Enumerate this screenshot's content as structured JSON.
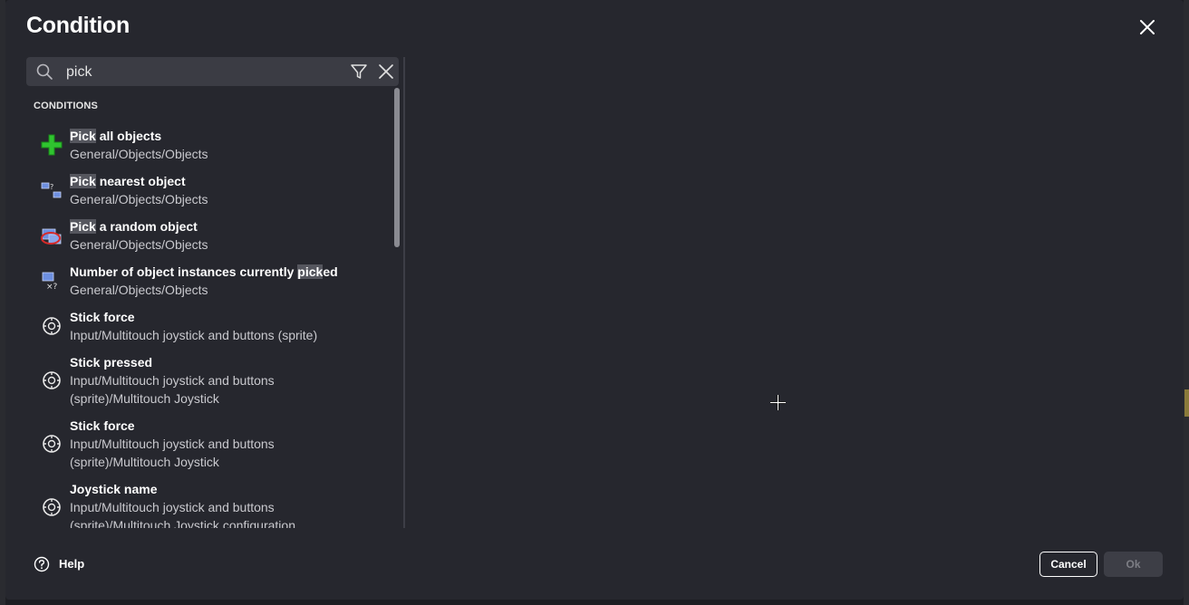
{
  "dialog": {
    "title": "Condition"
  },
  "search": {
    "value": "pick",
    "placeholder": ""
  },
  "list": {
    "section_label": "CONDITIONS",
    "items": [
      {
        "name_pre": "",
        "name_hl": "Pick",
        "name_post": " all objects",
        "path": "General/Objects/Objects",
        "icon": "green-plus-icon"
      },
      {
        "name_pre": "",
        "name_hl": "Pick",
        "name_post": " nearest object",
        "path": "General/Objects/Objects",
        "icon": "nearest-object-icon"
      },
      {
        "name_pre": "",
        "name_hl": "Pick",
        "name_post": " a random object",
        "path": "General/Objects/Objects",
        "icon": "random-object-icon"
      },
      {
        "name_pre": "Number of object instances currently ",
        "name_hl": "pick",
        "name_post": "ed",
        "path": "General/Objects/Objects",
        "icon": "object-count-icon"
      },
      {
        "name_pre": "Stick force",
        "name_hl": "",
        "name_post": "",
        "path": "Input/Multitouch joystick and buttons (sprite)",
        "icon": "joystick-icon"
      },
      {
        "name_pre": "Stick pressed",
        "name_hl": "",
        "name_post": "",
        "path": "Input/Multitouch joystick and buttons (sprite)/Multitouch Joystick",
        "icon": "joystick-icon"
      },
      {
        "name_pre": "Stick force",
        "name_hl": "",
        "name_post": "",
        "path": "Input/Multitouch joystick and buttons (sprite)/Multitouch Joystick",
        "icon": "joystick-icon"
      },
      {
        "name_pre": "Joystick name",
        "name_hl": "",
        "name_post": "",
        "path": "Input/Multitouch joystick and buttons (sprite)/Multitouch Joystick configuration",
        "icon": "joystick-icon"
      }
    ]
  },
  "footer": {
    "help_label": "Help",
    "cancel_label": "Cancel",
    "ok_label": "Ok"
  },
  "colors": {
    "dialog_bg": "#26272e",
    "search_bg": "#3b3c44",
    "highlight": "#55565e"
  }
}
